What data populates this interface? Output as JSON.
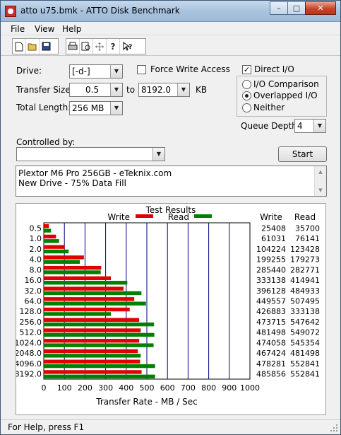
{
  "window": {
    "title": "atto u75.bmk - ATTO Disk Benchmark",
    "minimize": "–",
    "maximize": "□",
    "close": "✕"
  },
  "menu": {
    "items": [
      "File",
      "View",
      "Help"
    ]
  },
  "toolbar": {
    "icons": [
      "new-file-icon",
      "open-folder-icon",
      "save-icon",
      "print-icon",
      "print-preview-icon",
      "move-icon",
      "help-icon",
      "context-help-icon"
    ]
  },
  "settings": {
    "drive_label": "Drive:",
    "drive_value": "[-d-]",
    "force_write_label": "Force Write Access",
    "force_write_checked": false,
    "direct_io_label": "Direct I/O",
    "direct_io_checked": true,
    "transfer_size_label": "Transfer Size:",
    "transfer_from": "0.5",
    "to_label": "to",
    "transfer_to": "8192.0",
    "kb_label": "KB",
    "total_length_label": "Total Length:",
    "total_length_value": "256 MB",
    "io_options": [
      "I/O Comparison",
      "Overlapped I/O",
      "Neither"
    ],
    "io_selected": "Overlapped I/O",
    "queue_depth_label": "Queue Depth:",
    "queue_depth_value": "4",
    "controlled_by_label": "Controlled by:",
    "controlled_by_value": "",
    "start_label": "Start",
    "notes_line1": "Plextor M6 Pro 256GB - eTeknix.com",
    "notes_line2": "New Drive - 75% Data Fill"
  },
  "status": {
    "text": "For Help, press F1"
  },
  "chart_data": {
    "type": "bar",
    "title": "Test Results",
    "categories": [
      "0.5",
      "1.0",
      "2.0",
      "4.0",
      "8.0",
      "16.0",
      "32.0",
      "64.0",
      "128.0",
      "256.0",
      "512.0",
      "1024.0",
      "2048.0",
      "4096.0",
      "8192.0"
    ],
    "series": [
      {
        "name": "Write",
        "color": "#e00000",
        "values": [
          25408,
          61031,
          104224,
          199255,
          285440,
          333138,
          396128,
          449557,
          426883,
          473715,
          481498,
          474058,
          467424,
          478281,
          485856
        ]
      },
      {
        "name": "Read",
        "color": "#008000",
        "values": [
          35700,
          76141,
          123428,
          179273,
          282771,
          414941,
          484933,
          507495,
          333138,
          547642,
          549072,
          545354,
          481498,
          552841,
          552841
        ]
      }
    ],
    "column_headers": [
      "Write",
      "Read"
    ],
    "xlabel": "Transfer Rate - MB / Sec",
    "xlim": [
      0,
      1000
    ],
    "xticks": [
      "0",
      "100",
      "200",
      "300",
      "400",
      "500",
      "600",
      "700",
      "800",
      "900",
      "1000"
    ],
    "grid": true,
    "legend": "top"
  }
}
